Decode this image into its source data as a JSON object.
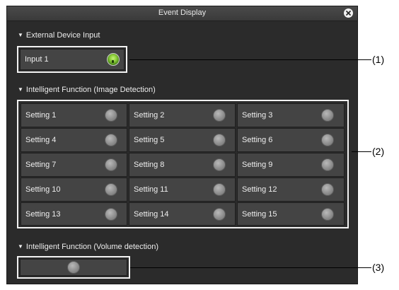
{
  "window": {
    "title": "Event Display"
  },
  "sections": {
    "external": {
      "title": "External Device Input",
      "items": [
        {
          "label": "Input 1",
          "state": "on"
        }
      ]
    },
    "intelligent_image": {
      "title": "Intelligent Function (Image Detection)",
      "items": [
        {
          "label": "Setting 1",
          "state": "off"
        },
        {
          "label": "Setting 2",
          "state": "off"
        },
        {
          "label": "Setting 3",
          "state": "off"
        },
        {
          "label": "Setting 4",
          "state": "off"
        },
        {
          "label": "Setting 5",
          "state": "off"
        },
        {
          "label": "Setting 6",
          "state": "off"
        },
        {
          "label": "Setting 7",
          "state": "off"
        },
        {
          "label": "Setting 8",
          "state": "off"
        },
        {
          "label": "Setting 9",
          "state": "off"
        },
        {
          "label": "Setting 10",
          "state": "off"
        },
        {
          "label": "Setting 11",
          "state": "off"
        },
        {
          "label": "Setting 12",
          "state": "off"
        },
        {
          "label": "Setting 13",
          "state": "off"
        },
        {
          "label": "Setting 14",
          "state": "off"
        },
        {
          "label": "Setting 15",
          "state": "off"
        }
      ]
    },
    "intelligent_volume": {
      "title": "Intelligent Function (Volume detection)",
      "state": "off"
    }
  },
  "callouts": [
    "(1)",
    "(2)",
    "(3)"
  ],
  "colors": {
    "dialog_bg": "#2b2b2b",
    "cell_bg": "#444444",
    "frame": "#f2f2f2",
    "lamp_on": "#8fd13c",
    "lamp_off": "#9a9a9a"
  }
}
